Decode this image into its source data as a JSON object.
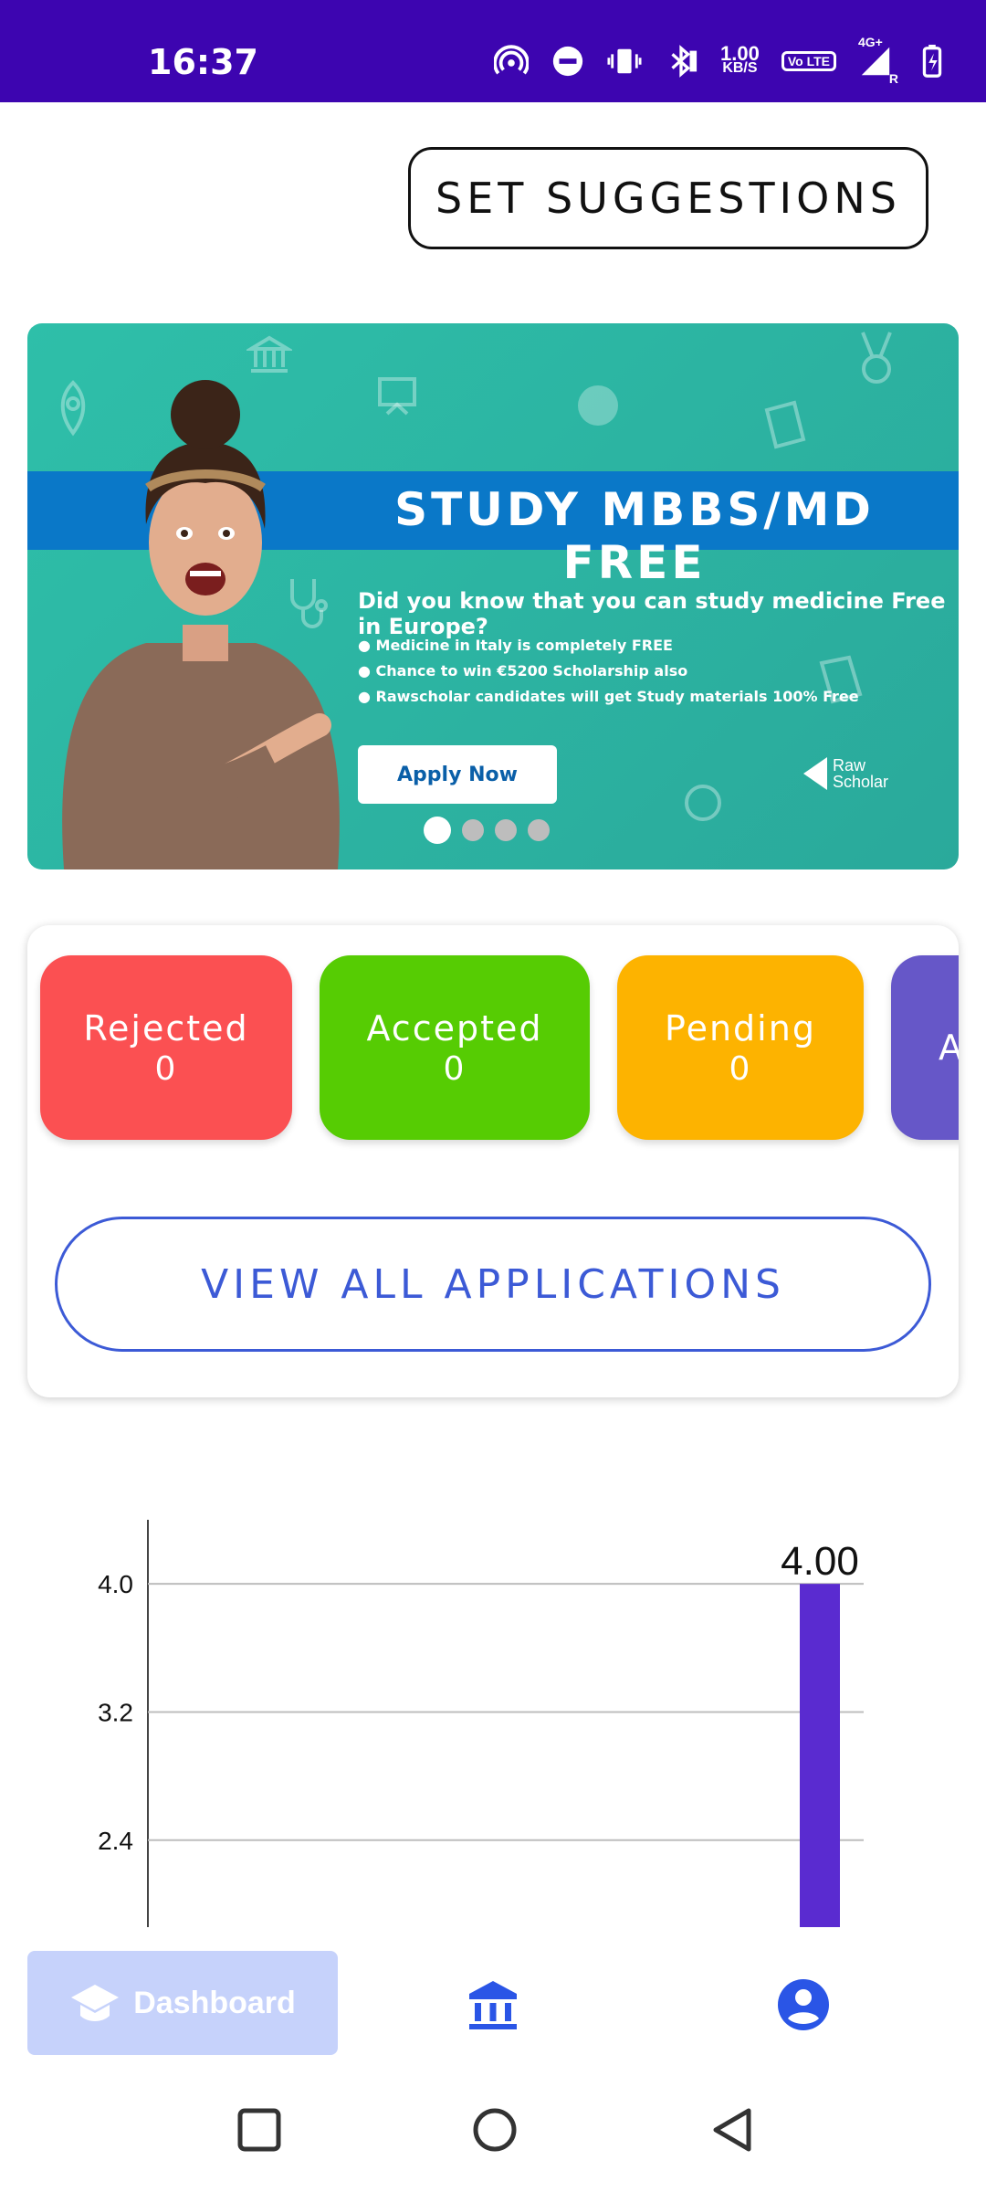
{
  "status_bar": {
    "time": "16:37",
    "speed_value": "1.00",
    "speed_unit": "KB/S",
    "volte": "Vo LTE",
    "network": "4G+",
    "roaming": "R",
    "icons": [
      "hotspot-icon",
      "dnd-icon",
      "vibrate-icon",
      "bluetooth-icon",
      "data-speed",
      "volte-icon",
      "signal-icon",
      "battery-icon"
    ]
  },
  "header": {
    "set_suggestions_label": "SET SUGGESTIONS"
  },
  "banner": {
    "headline": "STUDY MBBS/MD FREE",
    "subtitle": "Did you know that you can study medicine Free in Europe?",
    "bullets": [
      "Medicine in Italy is completely FREE",
      "Chance to win €5200  Scholarship also",
      "Rawscholar candidates will get Study materials 100% Free"
    ],
    "apply_label": "Apply Now",
    "brand_line1": "Raw",
    "brand_line2": "Scholar",
    "carousel_pages": 4,
    "active_page": 1
  },
  "applications": {
    "tiles": [
      {
        "label": "Rejected",
        "count": "0",
        "color": "#fb5052"
      },
      {
        "label": "Accepted",
        "count": "0",
        "color": "#56cc03"
      },
      {
        "label": "Pending",
        "count": "0",
        "color": "#fdb300"
      },
      {
        "label": "A",
        "count": "",
        "color": "#6657c8"
      }
    ],
    "view_all_label": "VIEW ALL APPLICATIONS"
  },
  "chart_data": {
    "type": "bar",
    "y_ticks": [
      "4.0",
      "3.2",
      "2.4"
    ],
    "bar_value": 4.0,
    "value_label": "4.00",
    "ylim": [
      1.8,
      4.4
    ],
    "grid": true,
    "bar_color": "#5a2bd0"
  },
  "bottom_nav": {
    "dashboard_label": "Dashboard",
    "active_color": "#c6d2fb",
    "icon_color": "#2a55e6",
    "items": [
      "graduation-cap-icon",
      "institution-icon",
      "account-circle-icon"
    ]
  },
  "system_nav": [
    "recents-button",
    "home-button",
    "back-button"
  ]
}
